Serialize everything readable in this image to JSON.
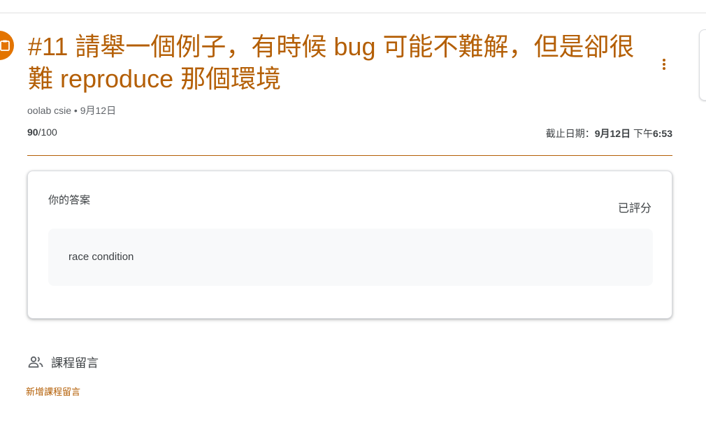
{
  "assignment": {
    "title": "#11 請舉一個例子，有時候 bug 可能不難解，但是卻很難 reproduce 那個環境",
    "author": "oolab csie",
    "meta_separator": " • ",
    "posted_date": "9月12日",
    "score": "90",
    "score_total": "/100",
    "due_prefix": "截止日期：",
    "due_date": "9月12日",
    "due_time_prefix": " 下午",
    "due_time": "6:53"
  },
  "submission": {
    "label": "你的答案",
    "status": "已評分",
    "answer": "race condition"
  },
  "comments": {
    "heading": "課程留言",
    "add_link": "新增課程留言"
  },
  "icons": {
    "type": "assignment-icon",
    "more": "more-vert-icon",
    "people": "people-icon"
  },
  "colors": {
    "accent": "#b45f06",
    "avatar": "#e37400",
    "answer_bg": "#f8f9fa"
  }
}
